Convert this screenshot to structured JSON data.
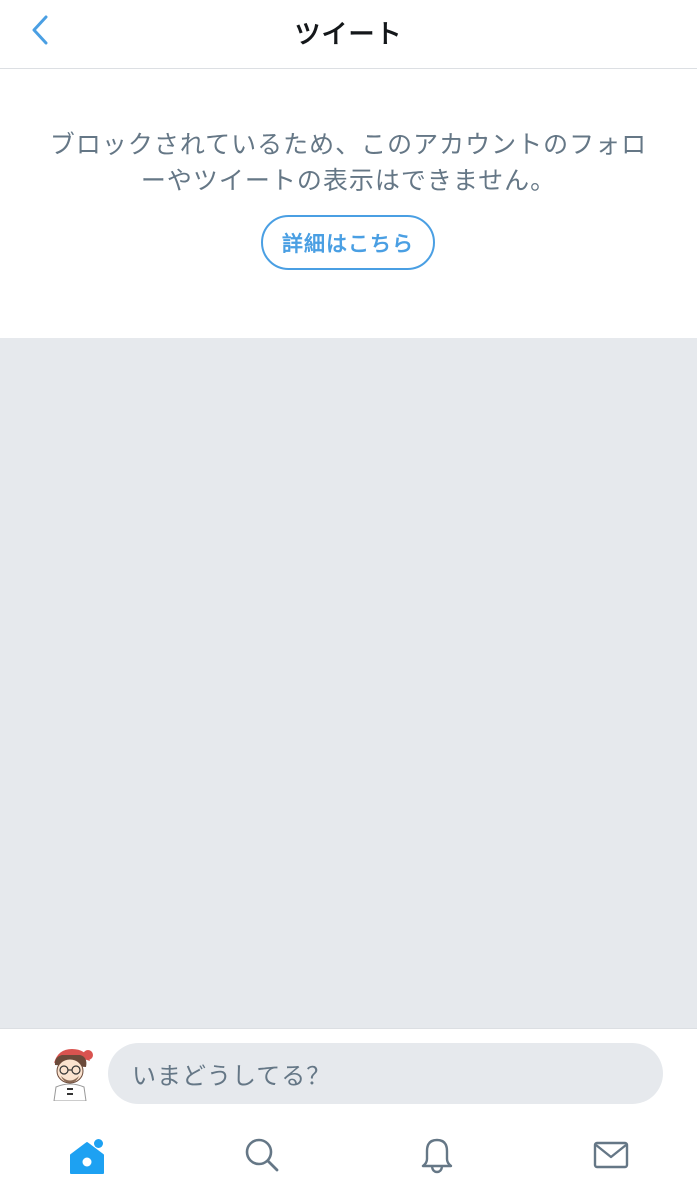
{
  "header": {
    "title": "ツイート",
    "back_icon": "chevron-left-icon"
  },
  "notice": {
    "message": "ブロックされているため、このアカウントのフォローやツイートの表示はできません。",
    "details_button": "詳細はこちら"
  },
  "compose": {
    "placeholder": "いまどうしてる？",
    "avatar_icon": "avatar"
  },
  "tab_bar": {
    "items": [
      {
        "icon": "home-icon",
        "active": true,
        "has_new_indicator": true
      },
      {
        "icon": "search-icon",
        "active": false
      },
      {
        "icon": "bell-icon",
        "active": false
      },
      {
        "icon": "envelope-icon",
        "active": false
      }
    ]
  },
  "colors": {
    "accent": "#1da1f2",
    "link": "#4a9fe3",
    "secondary_text": "#657786",
    "empty_background": "#e6e9ed",
    "divider": "#dcdfe3"
  }
}
